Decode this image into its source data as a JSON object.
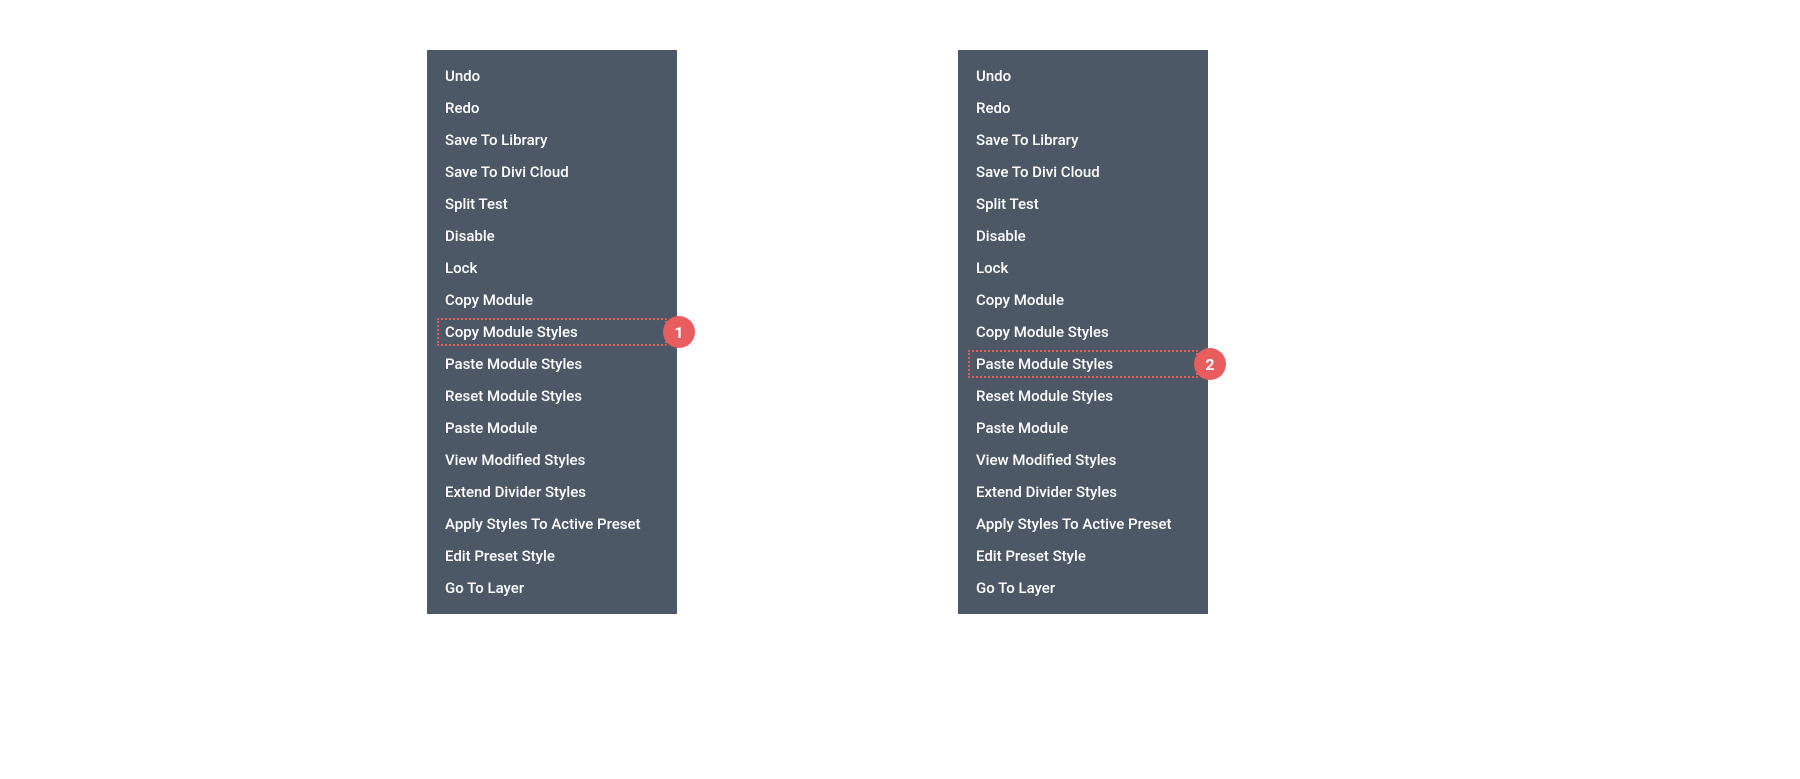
{
  "menus": {
    "left": {
      "highlighted_index": 8,
      "badge": "1",
      "items": [
        "Undo",
        "Redo",
        "Save To Library",
        "Save To Divi Cloud",
        "Split Test",
        "Disable",
        "Lock",
        "Copy Module",
        "Copy Module Styles",
        "Paste Module Styles",
        "Reset Module Styles",
        "Paste Module",
        "View Modified Styles",
        "Extend Divider Styles",
        "Apply Styles To Active Preset",
        "Edit Preset Style",
        "Go To Layer"
      ]
    },
    "right": {
      "highlighted_index": 9,
      "badge": "2",
      "items": [
        "Undo",
        "Redo",
        "Save To Library",
        "Save To Divi Cloud",
        "Split Test",
        "Disable",
        "Lock",
        "Copy Module",
        "Copy Module Styles",
        "Paste Module Styles",
        "Reset Module Styles",
        "Paste Module",
        "View Modified Styles",
        "Extend Divider Styles",
        "Apply Styles To Active Preset",
        "Edit Preset Style",
        "Go To Layer"
      ]
    }
  }
}
